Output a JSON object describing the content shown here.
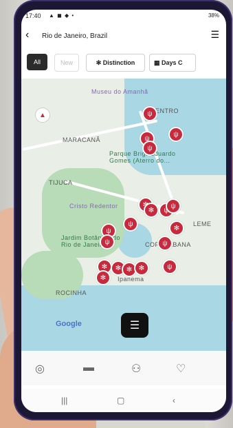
{
  "status_bar": {
    "time": "17:40",
    "icons": "▲ ◼ ◆ •",
    "battery": "38%"
  },
  "header": {
    "title": "Rio de Janeiro, Brazil"
  },
  "filters": [
    "All",
    "New",
    "Distinction",
    "Days C"
  ],
  "map": {
    "labels": [
      "Museu do Amanhã",
      "CENTRO",
      "MARACANÃ",
      "Parque Brig. Eduardo Gomes (Aterro do...",
      "TIJUCA",
      "Cristo Redentor",
      "Jardim Botânico do Rio de Janeiro",
      "COPACABANA",
      "LEME",
      "ROCINHA",
      "Ipanema",
      "Google"
    ]
  },
  "bottom_nav": [
    "michelin-guide",
    "hotels",
    "profile",
    "favorites"
  ],
  "system_nav": [
    "recent",
    "home",
    "back"
  ]
}
